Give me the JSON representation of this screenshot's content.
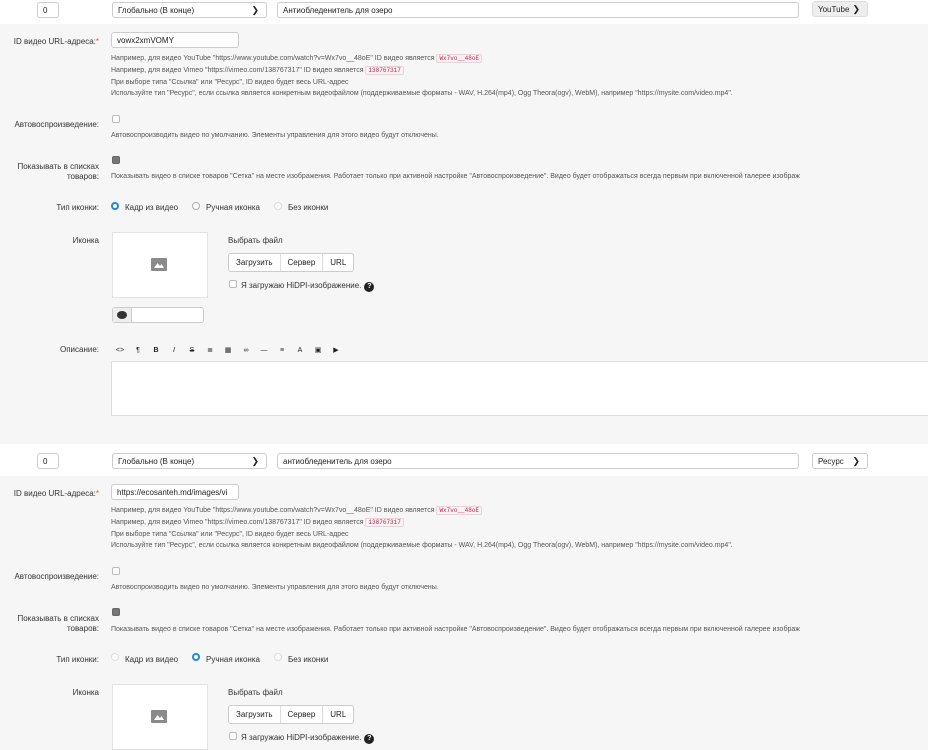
{
  "rows": [
    {
      "sort": "0",
      "scope": "Глобально (В конце)",
      "title": "Антиобледенитель для озеро",
      "type": "YouTube",
      "url_label": "ID видео URL-адреса:",
      "url_required": "*",
      "url_value": "vowx2xmVOMY",
      "help": {
        "yt_pre": "Например, для видео YouTube \"https://www.youtube.com/watch?v=Wx7vo__48oE\" ID видео является",
        "yt_code": "Wx7vo__48oE",
        "vimeo_pre": "Например, для видео Vimeo \"https://vimeo.com/138767317\" ID видео является",
        "vimeo_code": "138767317",
        "line3": "При выборе типа \"Ссылка\" или \"Ресурс\", ID видео будет весь URL-адрес",
        "line4": "Используйте тип \"Ресурс\", если ссылка является конкретным видеофайлом (поддерживаемые форматы - WAV, H.264(mp4), Ogg Theora(ogv), WebM), например \"https://mysite.com/video.mp4\"."
      },
      "autoplay_label": "Автовоспроизведение:",
      "autoplay_help": "Автовоспроизводить видео по умолчанию. Элементы управления для этого видео будут отключены.",
      "show_label_1": "Показывать в списках",
      "show_label_2": "товаров:",
      "show_help": "Показывать видео в списке товаров \"Сетка\" на месте изображения. Работает только при активной настройке \"Автовоспроизведение\". Видео будет отображаться всегда первым при включенной галерее изображ",
      "icon_type_label": "Тип иконки:",
      "icon_options": [
        "Кадр из видео",
        "Ручная иконка",
        "Без иконки"
      ],
      "icon_selected": 0,
      "icon_label": "Иконка",
      "choose_file": "Выбрать файл",
      "upload_buttons": [
        "Загрузить",
        "Сервер",
        "URL"
      ],
      "hidpi": "Я загружаю HiDPI-изображение.",
      "desc_label": "Описание:"
    },
    {
      "sort": "0",
      "scope": "Глобально (В конце)",
      "title": "антиобледенитель для озеро",
      "type": "Ресурс",
      "url_label": "ID видео URL-адреса:",
      "url_required": "*",
      "url_value": "https://ecosanteh.md/images/vi",
      "help": {
        "yt_pre": "Например, для видео YouTube \"https://www.youtube.com/watch?v=Wx7vo__48oE\" ID видео является",
        "yt_code": "Wx7vo__48oE",
        "vimeo_pre": "Например, для видео Vimeo \"https://vimeo.com/138767317\" ID видео является",
        "vimeo_code": "138767317",
        "line3": "При выборе типа \"Ссылка\" или \"Ресурс\", ID видео будет весь URL-адрес",
        "line4": "Используйте тип \"Ресурс\", если ссылка является конкретным видеофайлом (поддерживаемые форматы - WAV, H.264(mp4), Ogg Theora(ogv), WebM), например \"https://mysite.com/video.mp4\"."
      },
      "autoplay_label": "Автовоспроизведение:",
      "autoplay_help": "Автовоспроизводить видео по умолчанию. Элементы управления для этого видео будут отключены.",
      "show_label_1": "Показывать в списках",
      "show_label_2": "товаров:",
      "show_help": "Показывать видео в списке товаров \"Сетка\" на месте изображения. Работает только при активной настройке \"Автовоспроизведение\". Видео будет отображаться всегда первым при включенной галерее изображ",
      "icon_type_label": "Тип иконки:",
      "icon_options": [
        "Кадр из видео",
        "Ручная иконка",
        "Без иконки"
      ],
      "icon_selected": 1,
      "icon_label": "Иконка",
      "choose_file": "Выбрать файл",
      "upload_buttons": [
        "Загрузить",
        "Сервер",
        "URL"
      ],
      "hidpi": "Я загружаю HiDPI-изображение."
    }
  ],
  "editor_toolbar": [
    "<>",
    "¶",
    "B",
    "I",
    "S",
    "≣",
    "▦",
    "∞",
    "—",
    "≡",
    "A",
    "▣",
    "▶"
  ],
  "help_icon": "?",
  "icons": {
    "select_arrow": "chevron-down-icon",
    "image_placeholder": "image-icon",
    "color_swatch": "color-picker-icon",
    "help": "question-circle-icon"
  }
}
